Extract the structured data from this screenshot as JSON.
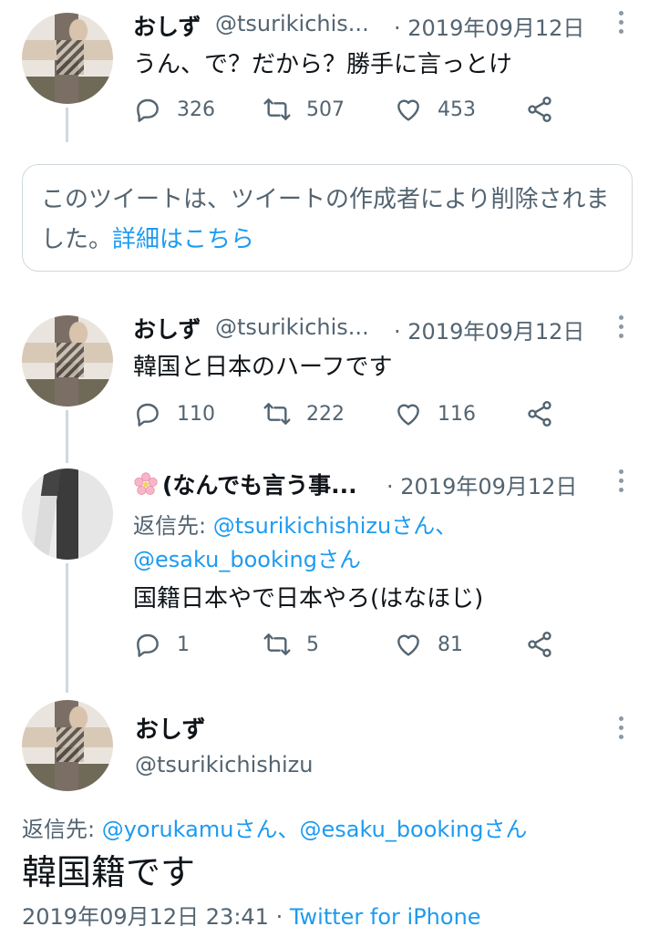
{
  "tweets": [
    {
      "name": "おしず",
      "handle": "@tsurikichis...",
      "date": "· 2019年09月12日",
      "text": "うん、で？だから？勝手に言っとけ",
      "replies": "326",
      "retweets": "507",
      "likes": "453"
    },
    {
      "name": "おしず",
      "handle": "@tsurikichis...",
      "date": "· 2019年09月12日",
      "text": "韓国と日本のハーフです",
      "replies": "110",
      "retweets": "222",
      "likes": "116"
    },
    {
      "name": "(なんでも言う事...",
      "date": "· 2019年09月12日",
      "reply_prefix": "返信先: ",
      "reply_user1": "@tsurikichishizuさん、",
      "reply_user2": "@esaku_bookingさん",
      "text": "国籍日本やで日本やろ(はなほじ)",
      "replies": "1",
      "retweets": "5",
      "likes": "81"
    }
  ],
  "deleted_notice": {
    "text": "このツイートは、ツイートの作成者により削除されました。",
    "link": "詳細はこちら"
  },
  "main_tweet": {
    "name": "おしず",
    "handle": "@tsurikichishizu",
    "reply_prefix": "返信先: ",
    "reply_user1": "@yorukamuさん、",
    "reply_user2": "@esaku_bookingさん",
    "text": "韓国籍です",
    "timestamp": "2019年09月12日 23:41 · ",
    "client": "Twitter for iPhone"
  },
  "icons": [
    "reply-icon",
    "retweet-icon",
    "like-icon",
    "share-icon",
    "more-icon",
    "cherry-blossom-icon"
  ],
  "colors": {
    "link": "#1d9bf0",
    "secondary": "#536471",
    "primary": "#0f1419",
    "border": "#cfd9de"
  }
}
